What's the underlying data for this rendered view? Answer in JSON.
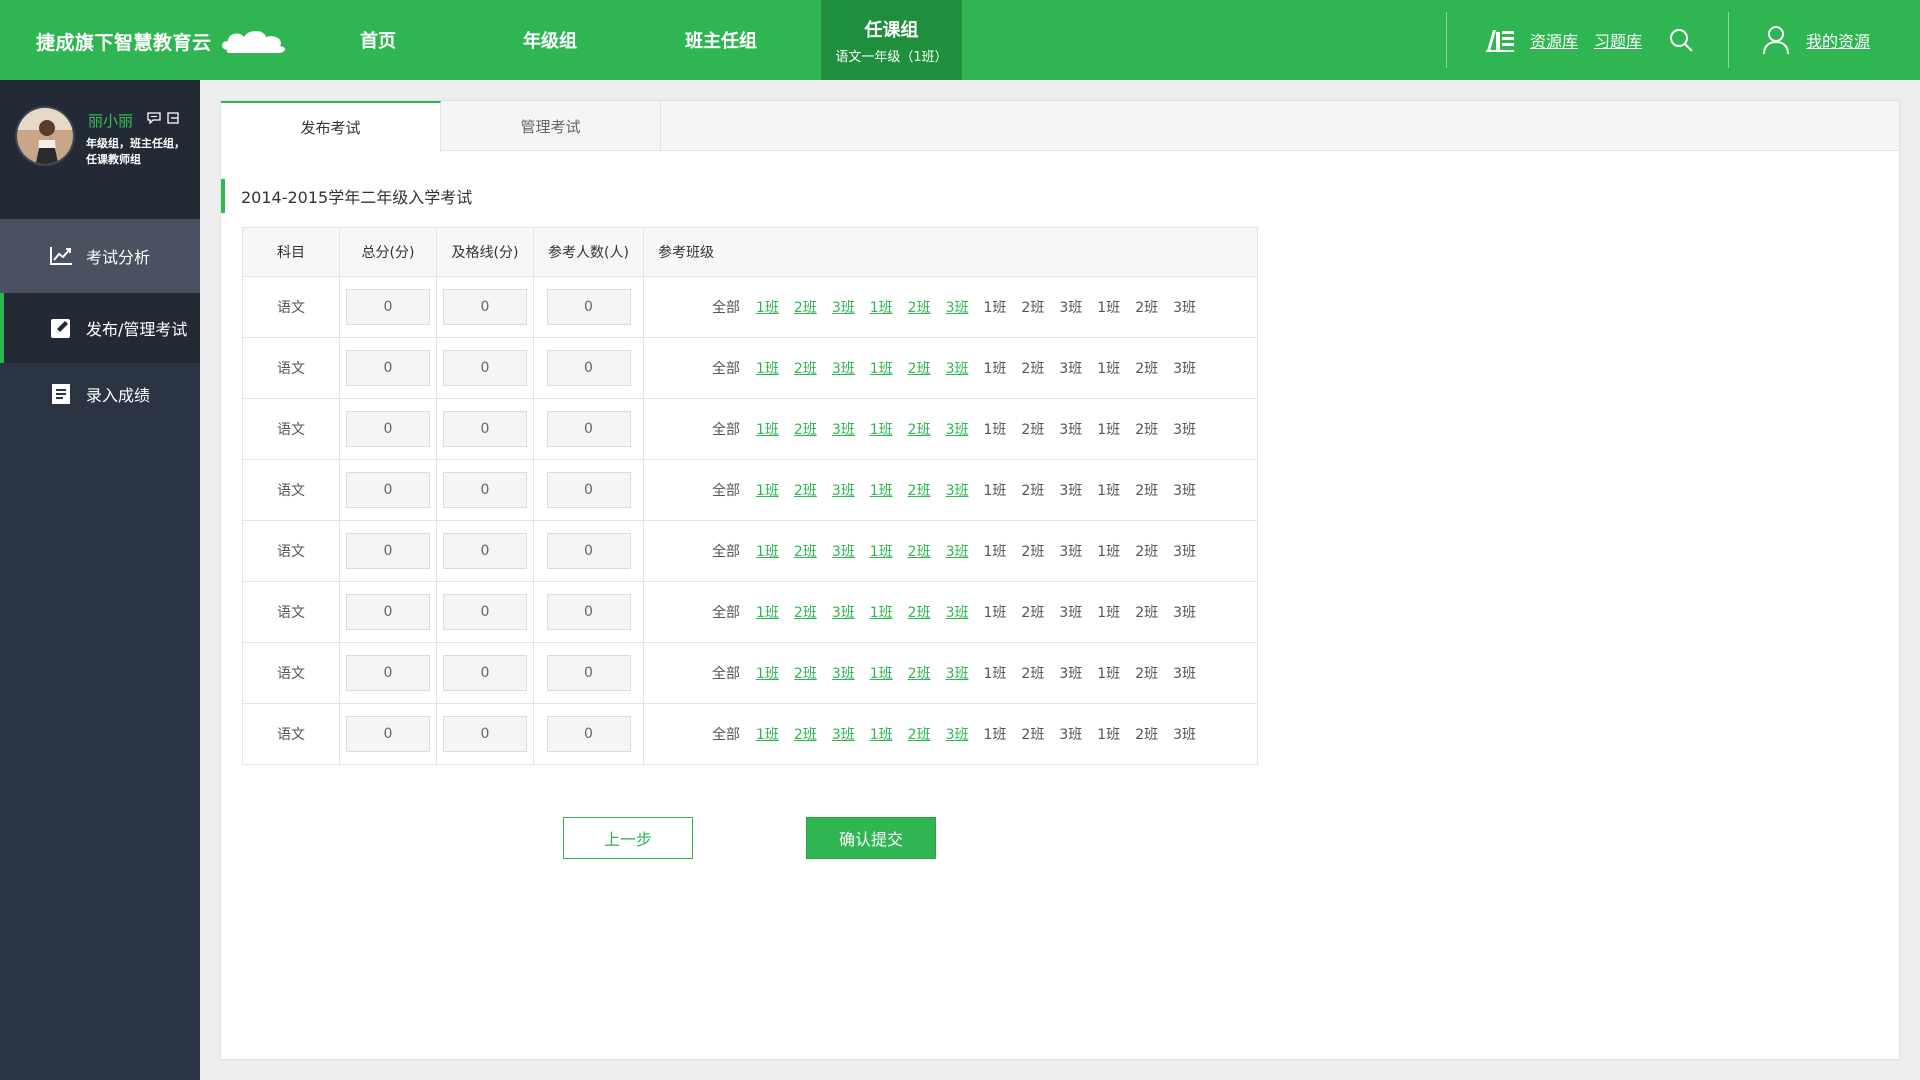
{
  "header": {
    "brand": "捷成旗下智慧教育云",
    "nav": [
      {
        "label": "首页",
        "sub": ""
      },
      {
        "label": "年级组",
        "sub": ""
      },
      {
        "label": "班主任组",
        "sub": ""
      },
      {
        "label": "任课组",
        "sub": "语文一年级（1班）"
      }
    ],
    "resource_library": "资源库",
    "exercise_library": "习题库",
    "my_resources": "我的资源"
  },
  "user": {
    "name": "丽小丽",
    "roles": "年级组，班主任组，任课教师组"
  },
  "sidebar": {
    "items": [
      {
        "label": "考试分析",
        "icon": "chart-line-icon"
      },
      {
        "label": "发布/管理考试",
        "icon": "edit-icon"
      },
      {
        "label": "录入成绩",
        "icon": "document-icon"
      }
    ]
  },
  "tabs": [
    {
      "label": "发布考试",
      "active": true
    },
    {
      "label": "管理考试",
      "active": false
    }
  ],
  "exam_title": "2014-2015学年二年级入学考试",
  "table": {
    "headers": [
      "科目",
      "总分(分)",
      "及格线(分)",
      "参考人数(人)",
      "参考班级"
    ],
    "all_label": "全部",
    "classes": [
      {
        "label": "1班",
        "selected": true
      },
      {
        "label": "2班",
        "selected": true
      },
      {
        "label": "3班",
        "selected": true
      },
      {
        "label": "1班",
        "selected": true
      },
      {
        "label": "2班",
        "selected": true
      },
      {
        "label": "3班",
        "selected": true
      },
      {
        "label": "1班",
        "selected": false
      },
      {
        "label": "2班",
        "selected": false
      },
      {
        "label": "3班",
        "selected": false
      },
      {
        "label": "1班",
        "selected": false
      },
      {
        "label": "2班",
        "selected": false
      },
      {
        "label": "3班",
        "selected": false
      }
    ],
    "rows": [
      {
        "subject": "语文",
        "total": "0",
        "pass": "0",
        "count": "0"
      },
      {
        "subject": "语文",
        "total": "0",
        "pass": "0",
        "count": "0"
      },
      {
        "subject": "语文",
        "total": "0",
        "pass": "0",
        "count": "0"
      },
      {
        "subject": "语文",
        "total": "0",
        "pass": "0",
        "count": "0"
      },
      {
        "subject": "语文",
        "total": "0",
        "pass": "0",
        "count": "0"
      },
      {
        "subject": "语文",
        "total": "0",
        "pass": "0",
        "count": "0"
      },
      {
        "subject": "语文",
        "total": "0",
        "pass": "0",
        "count": "0"
      },
      {
        "subject": "语文",
        "total": "0",
        "pass": "0",
        "count": "0"
      }
    ]
  },
  "buttons": {
    "prev": "上一步",
    "submit": "确认提交"
  },
  "colors": {
    "brand_green": "#2fb653",
    "active_nav": "#1e8f3c",
    "sidebar_bg": "#2b3443"
  }
}
